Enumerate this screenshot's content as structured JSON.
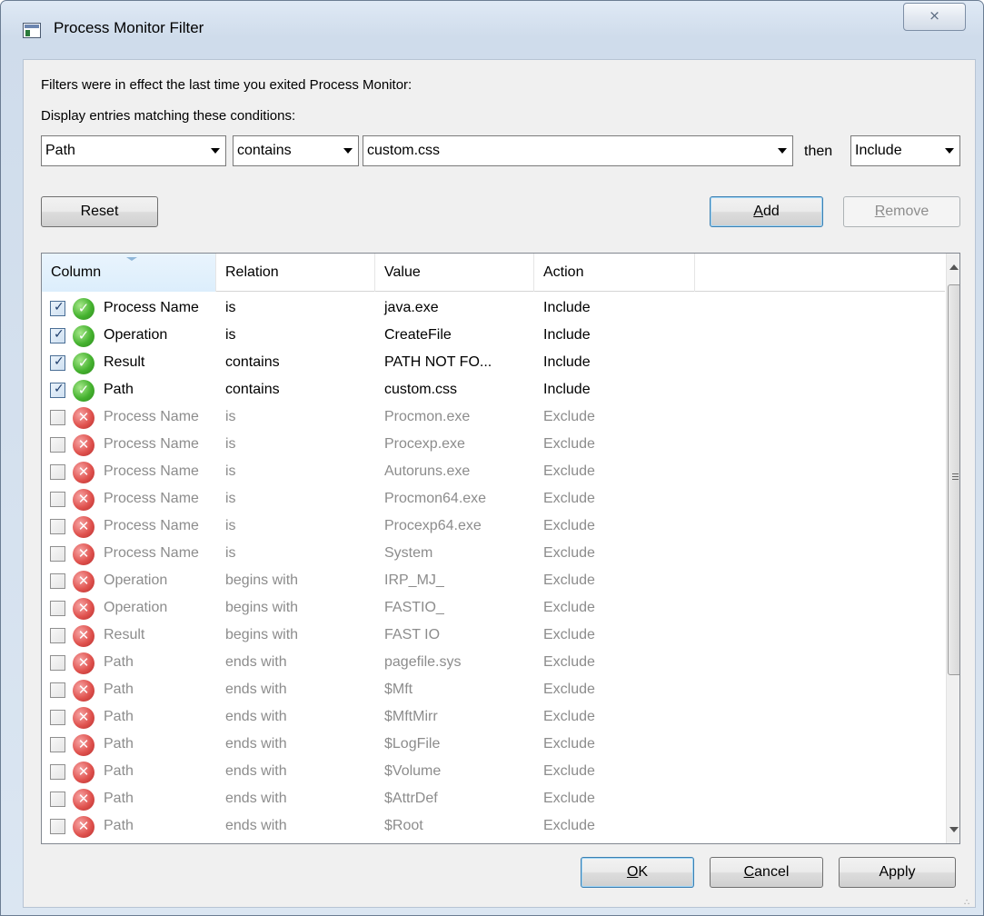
{
  "window": {
    "title": "Process Monitor Filter",
    "close_glyph": "⨯",
    "app_icon": "procmon-app-icon"
  },
  "intro": {
    "line1": "Filters were in effect the last time you exited Process Monitor:",
    "line2": "Display entries matching these conditions:"
  },
  "condition": {
    "column": "Path",
    "relation": "contains",
    "value": "custom.css",
    "then_label": "then",
    "action": "Include"
  },
  "buttons": {
    "reset": "Reset",
    "add_prefix": "",
    "add_key": "A",
    "add_rest": "dd",
    "remove_key": "R",
    "remove_rest": "emove",
    "ok_key": "O",
    "ok_rest": "K",
    "cancel_key": "C",
    "cancel_rest": "ancel",
    "apply": "Apply"
  },
  "table": {
    "headers": [
      "Column",
      "Relation",
      "Value",
      "Action"
    ],
    "rows": [
      {
        "checked": true,
        "status": "ok",
        "column": "Process Name",
        "relation": "is",
        "value": "java.exe",
        "action": "Include"
      },
      {
        "checked": true,
        "status": "ok",
        "column": "Operation",
        "relation": "is",
        "value": "CreateFile",
        "action": "Include"
      },
      {
        "checked": true,
        "status": "ok",
        "column": "Result",
        "relation": "contains",
        "value": "PATH NOT FO...",
        "action": "Include"
      },
      {
        "checked": true,
        "status": "ok",
        "column": "Path",
        "relation": "contains",
        "value": "custom.css",
        "action": "Include"
      },
      {
        "checked": false,
        "status": "no",
        "column": "Process Name",
        "relation": "is",
        "value": "Procmon.exe",
        "action": "Exclude"
      },
      {
        "checked": false,
        "status": "no",
        "column": "Process Name",
        "relation": "is",
        "value": "Procexp.exe",
        "action": "Exclude"
      },
      {
        "checked": false,
        "status": "no",
        "column": "Process Name",
        "relation": "is",
        "value": "Autoruns.exe",
        "action": "Exclude"
      },
      {
        "checked": false,
        "status": "no",
        "column": "Process Name",
        "relation": "is",
        "value": "Procmon64.exe",
        "action": "Exclude"
      },
      {
        "checked": false,
        "status": "no",
        "column": "Process Name",
        "relation": "is",
        "value": "Procexp64.exe",
        "action": "Exclude"
      },
      {
        "checked": false,
        "status": "no",
        "column": "Process Name",
        "relation": "is",
        "value": "System",
        "action": "Exclude"
      },
      {
        "checked": false,
        "status": "no",
        "column": "Operation",
        "relation": "begins with",
        "value": "IRP_MJ_",
        "action": "Exclude"
      },
      {
        "checked": false,
        "status": "no",
        "column": "Operation",
        "relation": "begins with",
        "value": "FASTIO_",
        "action": "Exclude"
      },
      {
        "checked": false,
        "status": "no",
        "column": "Result",
        "relation": "begins with",
        "value": "FAST IO",
        "action": "Exclude"
      },
      {
        "checked": false,
        "status": "no",
        "column": "Path",
        "relation": "ends with",
        "value": "pagefile.sys",
        "action": "Exclude"
      },
      {
        "checked": false,
        "status": "no",
        "column": "Path",
        "relation": "ends with",
        "value": "$Mft",
        "action": "Exclude"
      },
      {
        "checked": false,
        "status": "no",
        "column": "Path",
        "relation": "ends with",
        "value": "$MftMirr",
        "action": "Exclude"
      },
      {
        "checked": false,
        "status": "no",
        "column": "Path",
        "relation": "ends with",
        "value": "$LogFile",
        "action": "Exclude"
      },
      {
        "checked": false,
        "status": "no",
        "column": "Path",
        "relation": "ends with",
        "value": "$Volume",
        "action": "Exclude"
      },
      {
        "checked": false,
        "status": "no",
        "column": "Path",
        "relation": "ends with",
        "value": "$AttrDef",
        "action": "Exclude"
      },
      {
        "checked": false,
        "status": "no",
        "column": "Path",
        "relation": "ends with",
        "value": "$Root",
        "action": "Exclude"
      }
    ]
  },
  "colors": {
    "include_icon": "#45b22f",
    "exclude_icon": "#e0534f",
    "disabled_text": "#8c8c8c"
  }
}
